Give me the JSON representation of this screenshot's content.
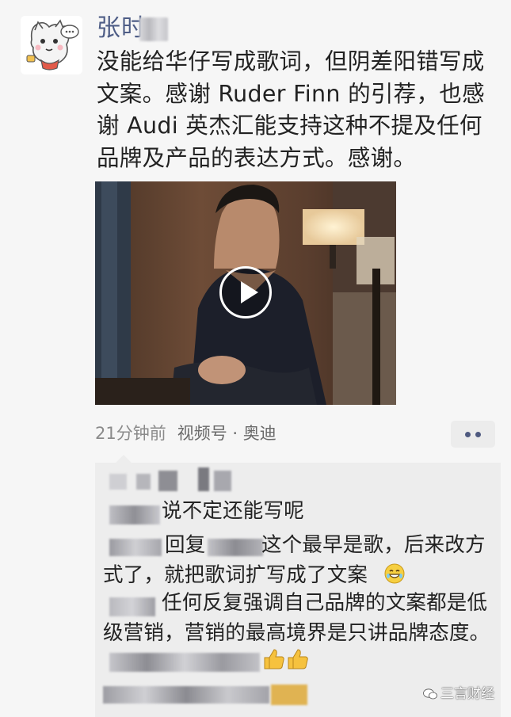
{
  "post": {
    "author_visible": "张时",
    "text": "没能给华仔写成歌词，但阴差阳错写成文案。感谢 Ruder Finn 的引荐，也感谢 Audi 英杰汇能支持这种不提及任何品牌及产品的表达方式。感谢。",
    "video": {
      "play_icon": "play-icon"
    },
    "meta": {
      "time": "21分钟前",
      "channel": "视频号 · 奥迪"
    },
    "more_icon": "more-dots-icon"
  },
  "comments": [
    {
      "text": "说不定还能写呢"
    },
    {
      "reply_keyword": "回复",
      "text_line1": "这个最早是歌，后来改方",
      "text_line2": "式了，就把歌词扩写成了文案",
      "emoji": "grin-emoji"
    },
    {
      "text_line1": "任何反复强调自己品牌的文案都是低",
      "text_line2": "级营销，营销的最高境界是只讲品牌态度。"
    },
    {
      "emoji": "👍👍"
    }
  ],
  "watermark": {
    "label": "三言财经",
    "icon": "wechat-icon"
  }
}
